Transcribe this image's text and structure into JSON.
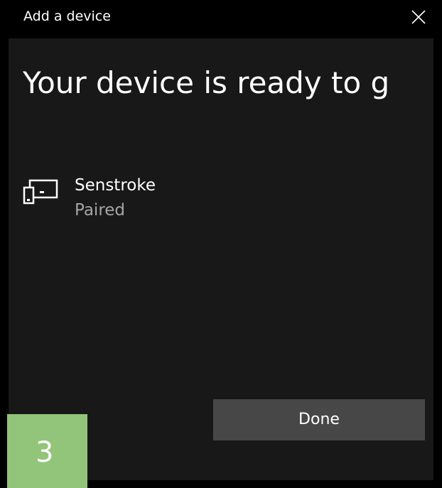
{
  "window": {
    "title": "Add a device",
    "close_icon": "close-icon"
  },
  "main": {
    "heading": "Your device is ready to g",
    "device": {
      "icon": "device-icon",
      "name": "Senstroke",
      "status": "Paired"
    },
    "done_label": "Done"
  },
  "badge": {
    "number": "3",
    "color": "#92c47a"
  },
  "colors": {
    "background": "#000000",
    "panel": "#181818",
    "button": "#474747",
    "secondary_text": "#a6a6a6"
  }
}
